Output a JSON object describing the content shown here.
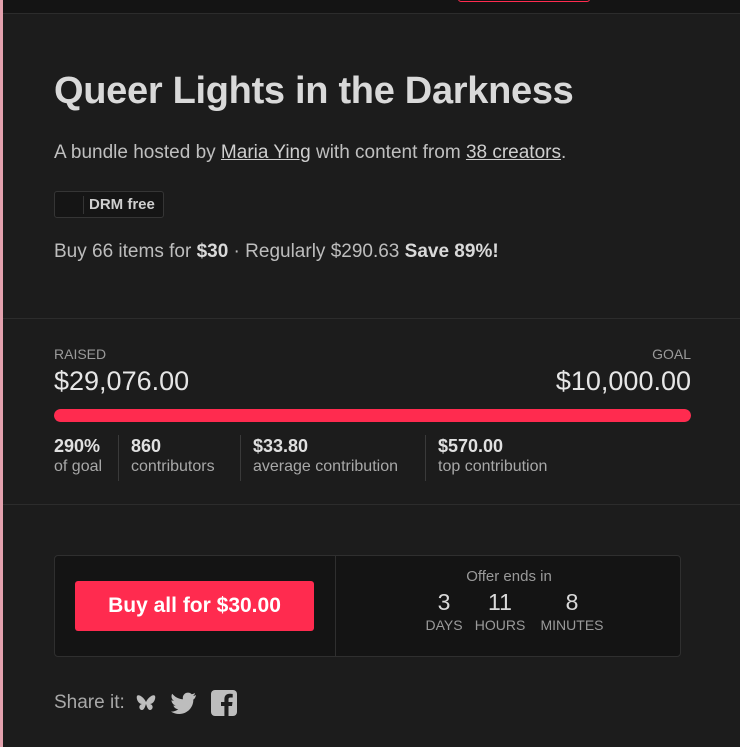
{
  "bundle": {
    "title": "Queer Lights in the Darkness",
    "byline_prefix": "A bundle hosted by ",
    "host": "Maria Ying",
    "byline_mid": " with content from ",
    "creators": "38 creators",
    "byline_end": ".",
    "drm_badge": "DRM free",
    "drm_icon": "download-icon",
    "offer_prefix": "Buy 66 items for ",
    "price": "$30",
    "offer_mid": " · Regularly $290.63 ",
    "savings": "Save 89%!"
  },
  "funding": {
    "raised_label": "RAISED",
    "raised_value": "$29,076.00",
    "goal_label": "GOAL",
    "goal_value": "$10,000.00",
    "progress_fraction": 1.0,
    "stats": [
      {
        "value": "290%",
        "label": "of goal"
      },
      {
        "value": "860",
        "label": "contributors"
      },
      {
        "value": "$33.80",
        "label": "average contribution"
      },
      {
        "value": "$570.00",
        "label": "top contribution"
      }
    ]
  },
  "purchase": {
    "buy_label": "Buy all for $30.00",
    "offer_ends_label": "Offer ends in",
    "countdown": [
      {
        "value": "3",
        "unit": "DAYS"
      },
      {
        "value": "11",
        "unit": "HOURS"
      },
      {
        "value": "8",
        "unit": "MINUTES"
      }
    ]
  },
  "share": {
    "label": "Share it:",
    "icons": [
      "bluesky-icon",
      "twitter-icon",
      "facebook-icon"
    ]
  },
  "colors": {
    "accent": "#ff2b4f",
    "background": "#1c1c1c"
  }
}
